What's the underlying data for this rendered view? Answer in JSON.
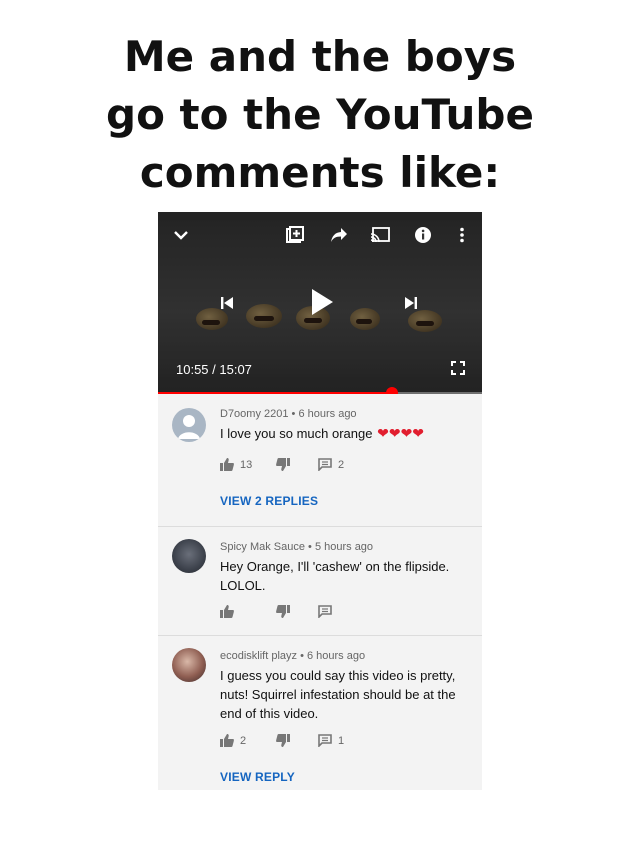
{
  "meme": {
    "title_lines": [
      "Me and the boys",
      "go to the YouTube",
      "comments like:"
    ]
  },
  "player": {
    "current_time": "10:55",
    "duration": "15:07",
    "time_label": "10:55 / 15:07",
    "progress_fraction": 0.7222,
    "accent_color": "#ff0000",
    "icons": [
      "chevron-down-icon",
      "add-to-playlist-icon",
      "share-icon",
      "cast-icon",
      "info-icon",
      "more-vert-icon",
      "previous-icon",
      "play-icon",
      "next-icon",
      "fullscreen-icon"
    ]
  },
  "comments": [
    {
      "author": "D7oomy 2201",
      "age": "6 hours ago",
      "meta": "D7oomy 2201 • 6 hours ago",
      "text": "I love you so much orange",
      "emoji": "❤❤❤❤",
      "likes": "13",
      "replies_count": "2",
      "replies_link": "VIEW 2 REPLIES"
    },
    {
      "author": "Spicy Mak Sauce",
      "age": "5 hours ago",
      "meta": "Spicy Mak Sauce • 5 hours ago",
      "text": "Hey Orange, I'll 'cashew' on the flipside. LOLOL.",
      "likes": "",
      "replies_count": ""
    },
    {
      "author": "ecodisklift playz",
      "age": "6 hours ago",
      "meta": "ecodisklift playz • 6 hours ago",
      "text": "I guess you could say this video is pretty, nuts! Squirrel infestation should be at the end of this video.",
      "likes": "2",
      "replies_count": "1",
      "replies_link": "VIEW REPLY"
    }
  ],
  "colors": {
    "link_blue": "#1565c0",
    "heart_red": "#e11d2e"
  }
}
